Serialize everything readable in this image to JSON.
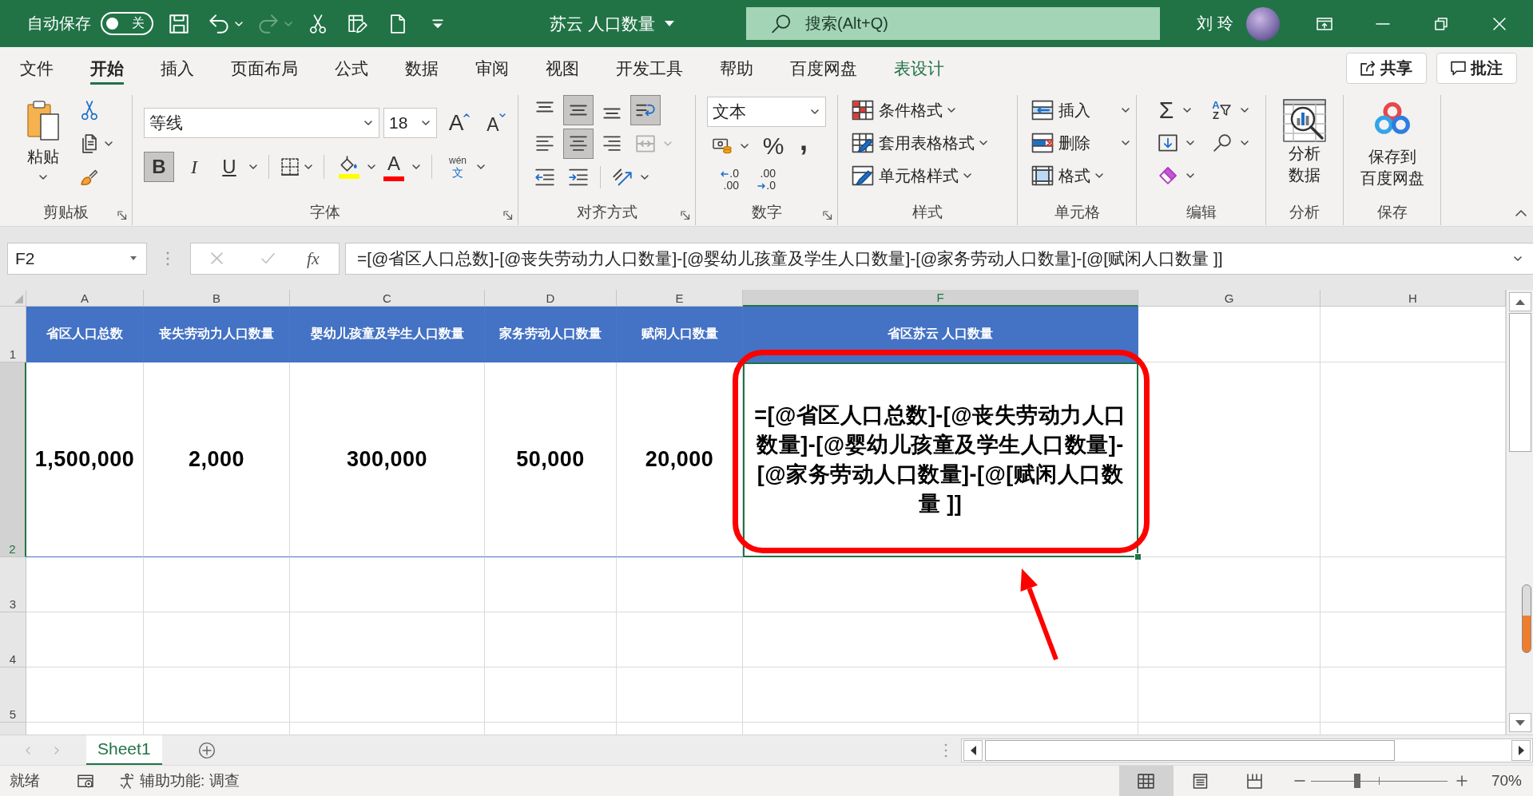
{
  "title_bar": {
    "autosave_label": "自动保存",
    "autosave_toggle": {
      "label": "关",
      "on": false
    },
    "quick_access": [
      {
        "kind": "save",
        "disabled": false,
        "dropdown": false
      },
      {
        "kind": "undo",
        "disabled": false,
        "dropdown": true
      },
      {
        "kind": "redo",
        "disabled": true,
        "dropdown": true
      },
      {
        "kind": "cut",
        "disabled": false,
        "dropdown": false
      },
      {
        "kind": "form",
        "disabled": false,
        "dropdown": false
      },
      {
        "kind": "new",
        "disabled": false,
        "dropdown": false
      },
      {
        "kind": "customize",
        "disabled": false,
        "dropdown": false
      }
    ],
    "document_title": "苏云 人口数量",
    "search": {
      "placeholder": "搜索(Alt+Q)"
    },
    "user_name": "刘 玲"
  },
  "menu_tabs": [
    {
      "label": "文件",
      "selected": false,
      "kind": "standard"
    },
    {
      "label": "开始",
      "selected": true,
      "kind": "standard"
    },
    {
      "label": "插入",
      "selected": false,
      "kind": "standard"
    },
    {
      "label": "页面布局",
      "selected": false,
      "kind": "standard"
    },
    {
      "label": "公式",
      "selected": false,
      "kind": "standard"
    },
    {
      "label": "数据",
      "selected": false,
      "kind": "standard"
    },
    {
      "label": "审阅",
      "selected": false,
      "kind": "standard"
    },
    {
      "label": "视图",
      "selected": false,
      "kind": "standard"
    },
    {
      "label": "开发工具",
      "selected": false,
      "kind": "standard"
    },
    {
      "label": "帮助",
      "selected": false,
      "kind": "standard"
    },
    {
      "label": "百度网盘",
      "selected": false,
      "kind": "standard"
    },
    {
      "label": "表设计",
      "selected": false,
      "kind": "contextual"
    }
  ],
  "header_buttons": [
    {
      "kind": "share",
      "label": "共享"
    },
    {
      "kind": "comments",
      "label": "批注"
    }
  ],
  "ribbon": {
    "groups": [
      {
        "kind": "clipboard",
        "label": "剪贴板",
        "launcher": true,
        "paste_label": "粘贴"
      },
      {
        "kind": "font",
        "label": "字体",
        "launcher": true,
        "font_name": "等线",
        "font_size": "18",
        "grow_glyph": "A",
        "shrink_glyph": "A",
        "styles": [
          {
            "kind": "bold",
            "glyph": "B",
            "selected": true
          },
          {
            "kind": "italic",
            "glyph": "I",
            "selected": false
          },
          {
            "kind": "underline",
            "glyph": "U",
            "selected": false
          }
        ],
        "fill_color": {
          "color": "#ffff00"
        },
        "font_color": {
          "glyph": "A",
          "color": "#ff0000"
        },
        "phonetic": {
          "top": "wén",
          "bottom": "文"
        }
      },
      {
        "kind": "alignment",
        "label": "对齐方式",
        "launcher": true,
        "vertical": [
          {
            "kind": "top",
            "selected": false
          },
          {
            "kind": "middle",
            "selected": true
          },
          {
            "kind": "bottom",
            "selected": false
          }
        ],
        "wrap_text": {
          "selected": true
        },
        "horizontal": [
          {
            "kind": "left",
            "selected": false
          },
          {
            "kind": "center",
            "selected": true
          },
          {
            "kind": "right",
            "selected": false
          }
        ],
        "merge": {
          "disabled": true
        }
      },
      {
        "kind": "number",
        "label": "数字",
        "launcher": true,
        "format": "文本",
        "percent_glyph": "%",
        "comma_glyph": ",",
        "decimals": [
          {
            "kind": "increase",
            "top": ".0",
            "bottom": ".00"
          },
          {
            "kind": "decrease",
            "top": ".00",
            "bottom": ".0"
          }
        ]
      },
      {
        "kind": "styles",
        "label": "样式",
        "launcher": false,
        "commands": [
          {
            "kind": "conditional",
            "label": "条件格式"
          },
          {
            "kind": "table",
            "label": "套用表格格式"
          },
          {
            "kind": "cell_styles",
            "label": "单元格样式"
          }
        ]
      },
      {
        "kind": "cells",
        "label": "单元格",
        "launcher": false,
        "commands": [
          {
            "kind": "insert",
            "label": "插入"
          },
          {
            "kind": "delete",
            "label": "删除"
          },
          {
            "kind": "format",
            "label": "格式"
          }
        ]
      },
      {
        "kind": "editing",
        "label": "编辑",
        "launcher": false,
        "sum_glyph": "Σ",
        "sort_glyphs": {
          "top": "A",
          "bottom": "Z"
        }
      },
      {
        "kind": "analysis",
        "label": "分析",
        "launcher": false,
        "button_lines": [
          "分析",
          "数据"
        ]
      },
      {
        "kind": "save",
        "label": "保存",
        "launcher": false,
        "button_lines": [
          "保存到",
          "百度网盘"
        ]
      }
    ]
  },
  "formula_bar": {
    "name_box": "F2",
    "edit_buttons": [
      {
        "kind": "cancel",
        "disabled": true
      },
      {
        "kind": "enter",
        "disabled": true
      }
    ],
    "function_label": "fx",
    "formula": "=[@省区人口总数]-[@丧失劳动力人口数量]-[@婴幼儿孩童及学生人口数量]-[@家务劳动人口数量]-[@[赋闲人口数量 ]]"
  },
  "sheet": {
    "columns": [
      {
        "label": "A",
        "selected": false
      },
      {
        "label": "B",
        "selected": false
      },
      {
        "label": "C",
        "selected": false
      },
      {
        "label": "D",
        "selected": false
      },
      {
        "label": "E",
        "selected": false
      },
      {
        "label": "F",
        "selected": true
      },
      {
        "label": "G",
        "selected": false
      },
      {
        "label": "H",
        "selected": false
      }
    ],
    "rows": [
      {
        "label": "1",
        "selected": false,
        "kind": "table_header",
        "cells": [
          {
            "text": "省区人口总数",
            "selected": false
          },
          {
            "text": "丧失劳动力人口数量",
            "selected": false
          },
          {
            "text": "婴幼儿孩童及学生人口数量",
            "selected": false
          },
          {
            "text": "家务劳动人口数量",
            "selected": false
          },
          {
            "text": "赋闲人口数量",
            "selected": false
          },
          {
            "text": "省区苏云 人口数量",
            "selected": false
          }
        ]
      },
      {
        "label": "2",
        "selected": true,
        "kind": "table_data",
        "cells": [
          {
            "text": "1,500,000",
            "selected": false
          },
          {
            "text": "2,000",
            "selected": false
          },
          {
            "text": "300,000",
            "selected": false
          },
          {
            "text": "50,000",
            "selected": false
          },
          {
            "text": "20,000",
            "selected": false
          },
          {
            "text": "=[@省区人口总数]-[@丧失劳动力人口数量]-[@婴幼儿孩童及学生人口数量]-[@家务劳动人口数量]-[@[赋闲人口数量 ]]",
            "selected": true
          }
        ]
      },
      {
        "label": "3",
        "selected": false,
        "kind": "empty"
      },
      {
        "label": "4",
        "selected": false,
        "kind": "empty"
      },
      {
        "label": "5",
        "selected": false,
        "kind": "empty"
      }
    ]
  },
  "sheet_bar": {
    "nav": [
      {
        "kind": "previous",
        "disabled": true
      },
      {
        "kind": "next",
        "disabled": true
      }
    ],
    "tabs": [
      {
        "label": "Sheet1",
        "selected": true
      }
    ]
  },
  "status_bar": {
    "ready": "就绪",
    "accessibility": "辅助功能: 调查",
    "views": [
      {
        "kind": "normal",
        "selected": true
      },
      {
        "kind": "page_layout",
        "selected": false
      },
      {
        "kind": "page_break",
        "selected": false
      }
    ],
    "zoom": {
      "level": 0.34,
      "reading": "70%"
    }
  }
}
